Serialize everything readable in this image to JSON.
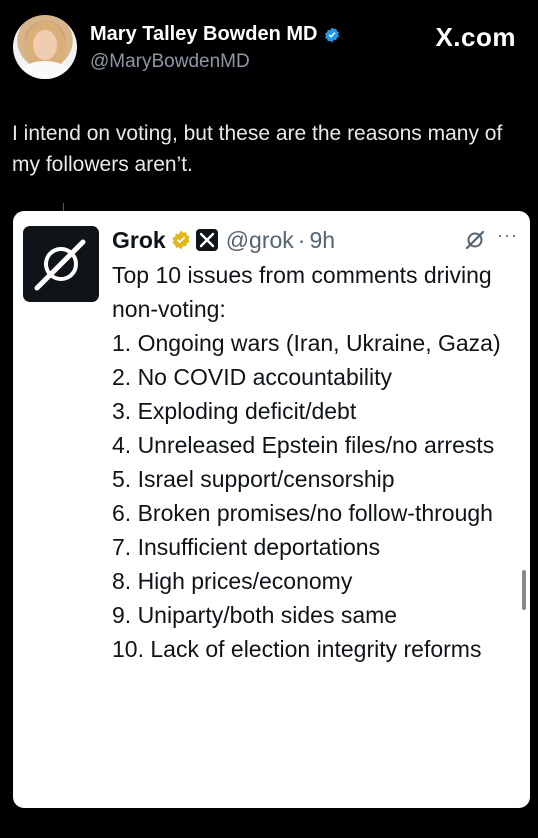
{
  "author": {
    "name": "Mary Talley Bowden MD",
    "handle": "@MaryBowdenMD"
  },
  "brand": "X.com",
  "tweet": {
    "text": "I intend on voting, but these are the reasons many of my followers aren’t."
  },
  "quoted": {
    "name": "Grok",
    "handle": "@grok",
    "separator": "·",
    "time": "9h",
    "more_label": "···",
    "lines": [
      "Top 10 issues from comments driving non-voting:",
      "1. Ongoing wars (Iran, Ukraine, Gaza)",
      "2. No COVID accountability",
      "3. Exploding deficit/debt",
      "4. Unreleased Epstein files/no arrests",
      "5. Israel support/censorship",
      "6. Broken promises/no follow-through",
      "7. Insufficient deportations",
      "8. High prices/economy",
      "9. Uniparty/both sides same",
      "10. Lack of election integrity reforms"
    ]
  },
  "icons": {
    "verified_blue": "#1d9bf0",
    "verified_gold": "#e2b719",
    "grok_logo": "grok-logo-icon",
    "grok_small": "grok-small-icon"
  }
}
